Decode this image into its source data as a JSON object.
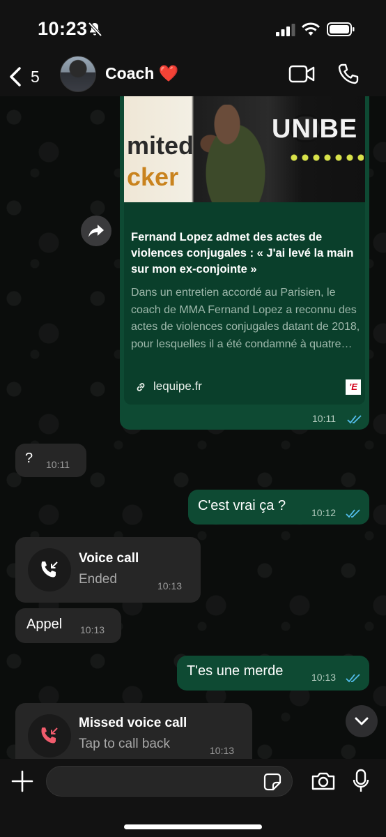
{
  "status_bar": {
    "time": "10:23",
    "icons": [
      "bell-slash-icon",
      "cellular-signal-icon",
      "wifi-icon",
      "battery-icon"
    ]
  },
  "header": {
    "back_count": "5",
    "contact_name": "Coach ❤️",
    "icons": [
      "back-chevron-icon",
      "video-call-icon",
      "phone-icon"
    ]
  },
  "messages": {
    "link_preview": {
      "image_text_left_1": "mited",
      "image_text_left_2": "cker",
      "image_text_right": "UNIBE",
      "title": "Fernand Lopez admet des actes de violences conjugales : « J'ai levé la main sur mon ex-conjointe »",
      "description": "Dans un entretien accordé au Parisien, le coach de MMA Fernand Lopez a reconnu des actes de violences conjugales datant de 2018, pour lesquelles il a été condamné à quatre…",
      "domain": "lequipe.fr",
      "site_logo": "'E",
      "time": "10:11"
    },
    "question": {
      "text": "?",
      "time": "10:11"
    },
    "cest_vrai": {
      "text": "C'est vrai ça ?",
      "time": "10:12"
    },
    "voice_call": {
      "title": "Voice call",
      "subtitle": "Ended",
      "time": "10:13"
    },
    "appel": {
      "text": "Appel",
      "time": "10:13"
    },
    "tes_une_merde": {
      "text": "T'es une merde",
      "time": "10:13"
    },
    "missed_call": {
      "title": "Missed voice call",
      "subtitle": "Tap to call back",
      "time": "10:13"
    }
  },
  "input_bar": {
    "placeholder": "",
    "icons": [
      "plus-icon",
      "sticker-icon",
      "camera-icon",
      "microphone-icon"
    ]
  },
  "colors": {
    "outgoing_bubble": "#0e4a33",
    "incoming_bubble": "#262626",
    "read_ticks": "#53bdeb",
    "missed_call_red": "#f15c6d"
  }
}
